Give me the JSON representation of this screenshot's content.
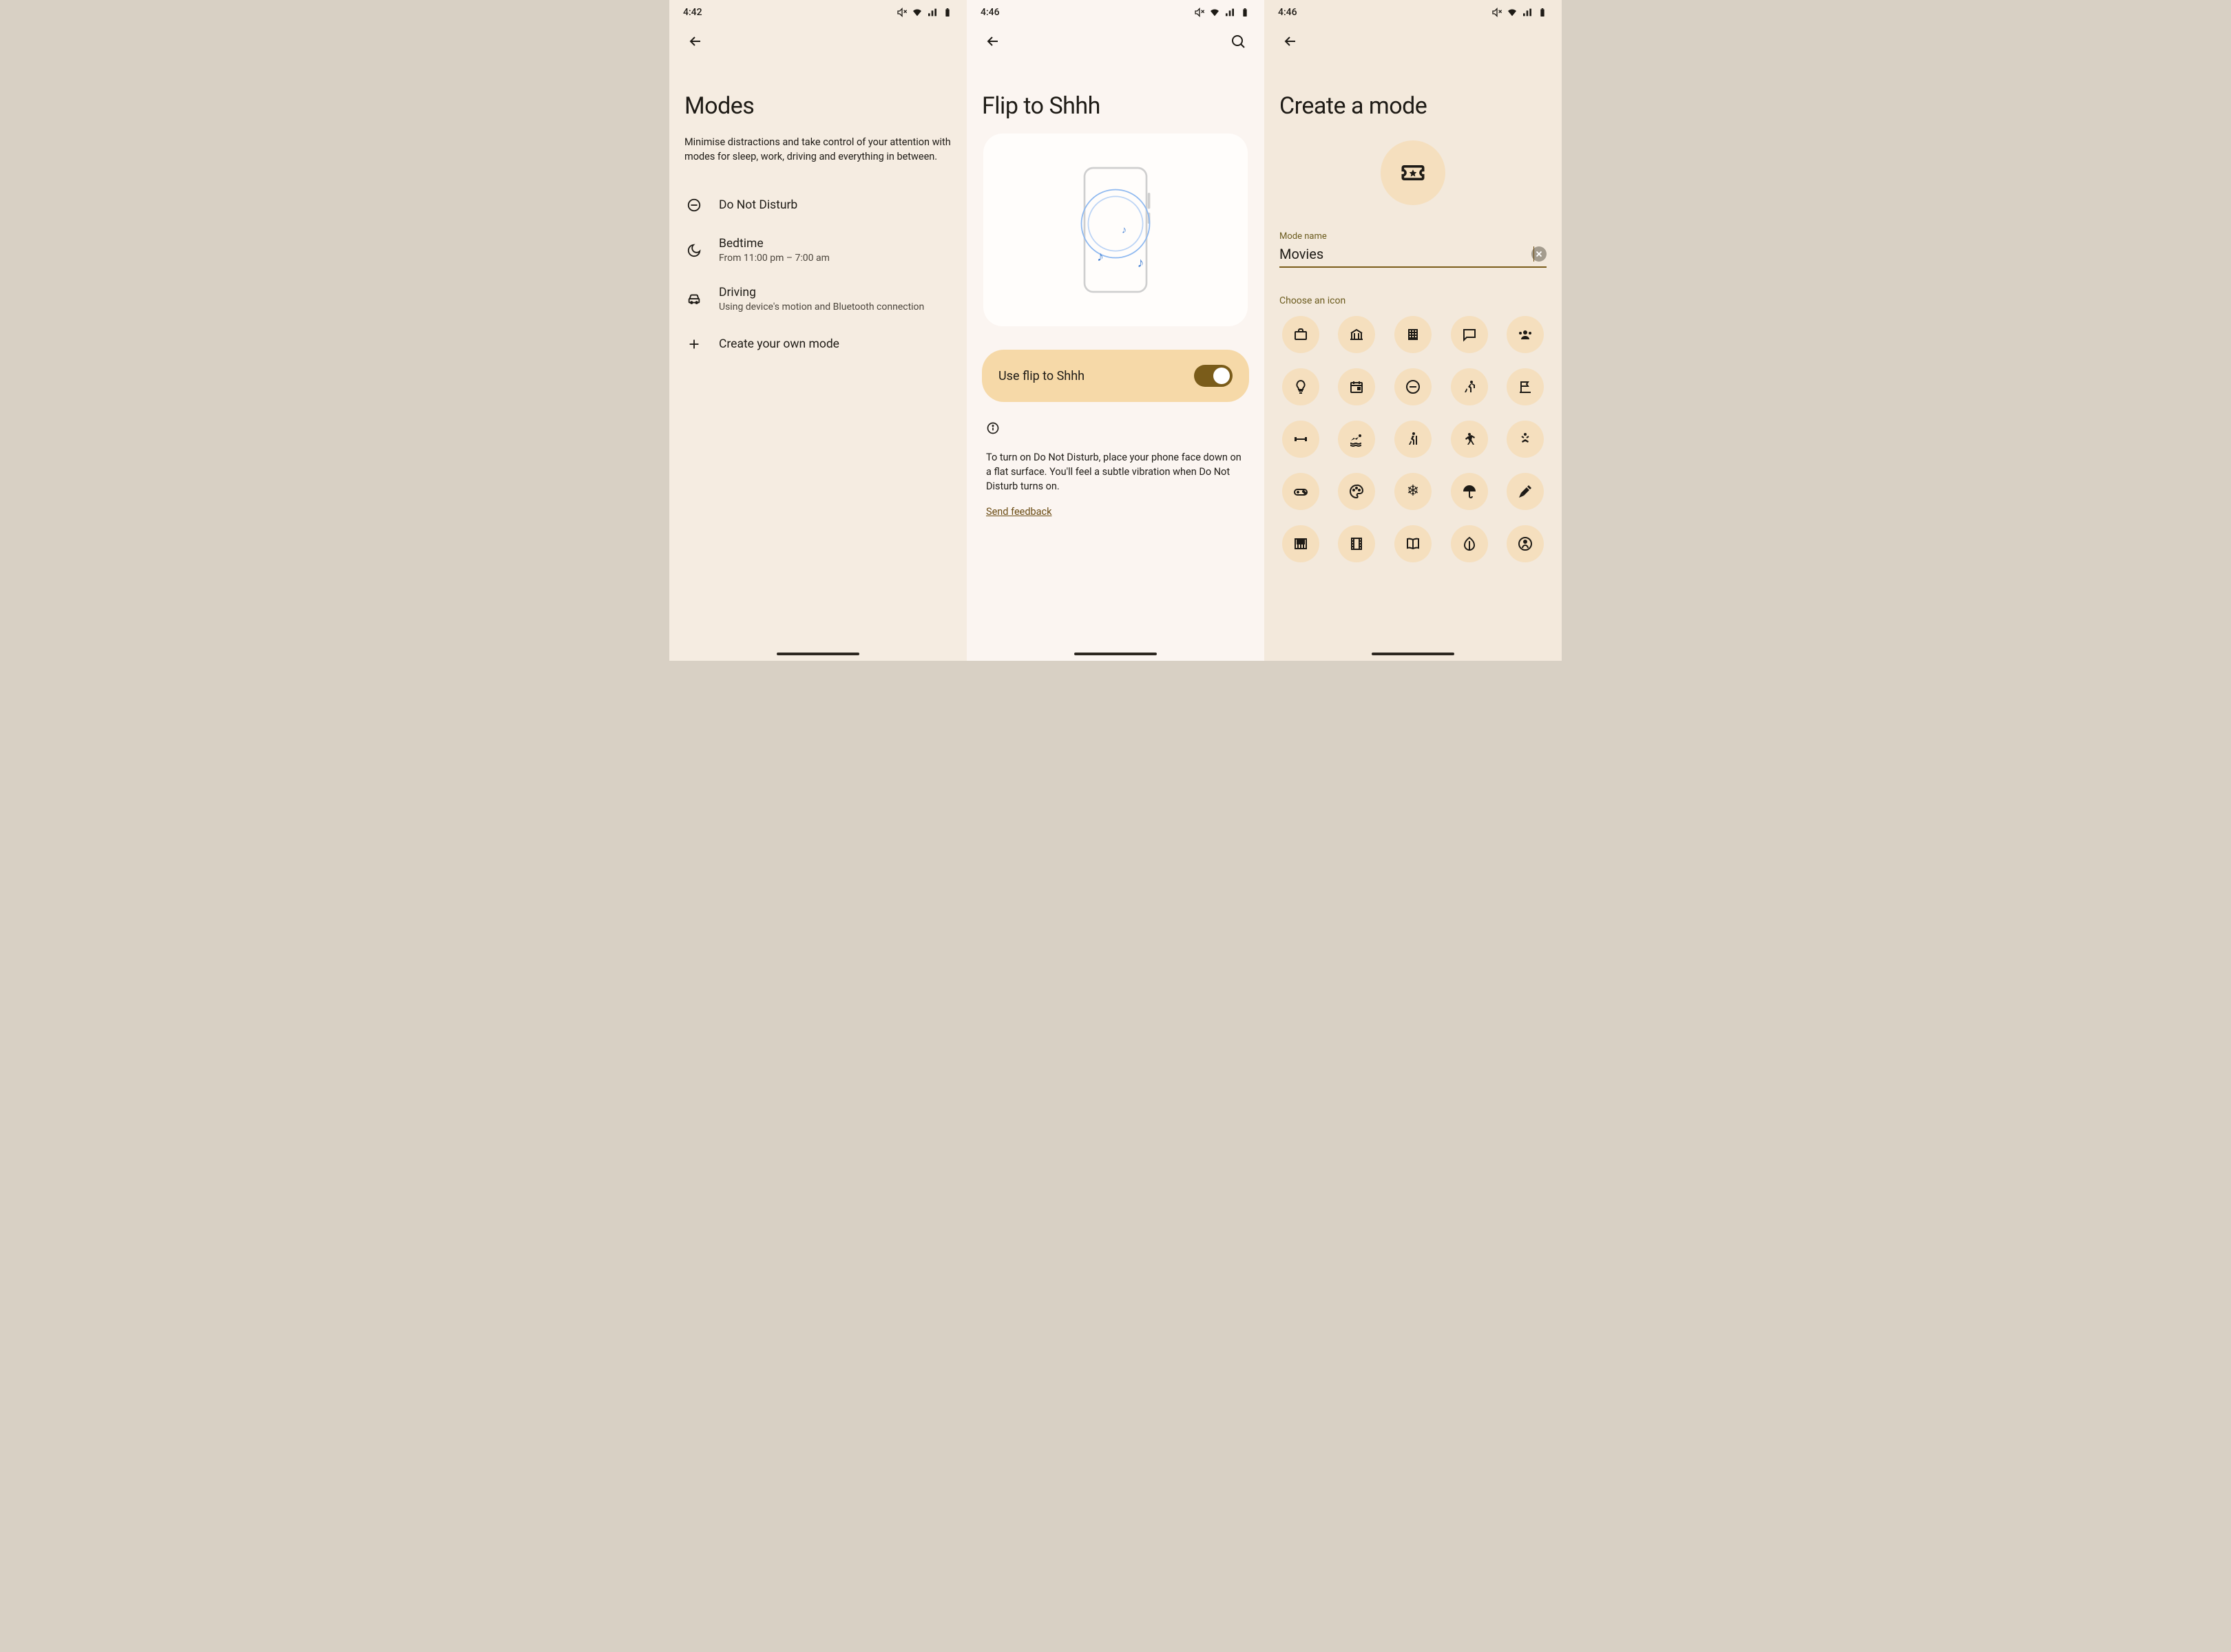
{
  "status": {
    "time_modes": "4:42",
    "time_flip": "4:46",
    "time_create": "4:46"
  },
  "modes_screen": {
    "title": "Modes",
    "subtitle": "Minimise distractions and take control of your attention with modes for sleep, work, driving and everything in between.",
    "items": [
      {
        "title": "Do Not Disturb",
        "sub": ""
      },
      {
        "title": "Bedtime",
        "sub": "From 11:00 pm – 7:00 am"
      },
      {
        "title": "Driving",
        "sub": "Using device's motion and Bluetooth connection"
      },
      {
        "title": "Create your own mode",
        "sub": ""
      }
    ]
  },
  "flip_screen": {
    "title": "Flip to Shhh",
    "toggle_label": "Use flip to Shhh",
    "toggle_on": true,
    "info_text": "To turn on Do Not Disturb, place your phone face down on a flat surface. You'll feel a subtle vibration when Do Not Disturb turns on.",
    "feedback": "Send feedback"
  },
  "create_screen": {
    "title": "Create a mode",
    "field_label": "Mode name",
    "field_value": "Movies",
    "choose_label": "Choose an icon",
    "icons": [
      "briefcase-icon",
      "bank-icon",
      "building-icon",
      "chat-icon",
      "group-icon",
      "bulb-icon",
      "calendar-icon",
      "dnd-icon",
      "running-icon",
      "flag-icon",
      "dumbbell-icon",
      "swimming-icon",
      "hiking-icon",
      "dance-icon",
      "yoga-icon",
      "gamepad-icon",
      "palette-icon",
      "snowflake-icon",
      "umbrella-icon",
      "tools-icon",
      "piano-icon",
      "film-icon",
      "book-icon",
      "leaf-icon",
      "wellness-icon"
    ]
  }
}
